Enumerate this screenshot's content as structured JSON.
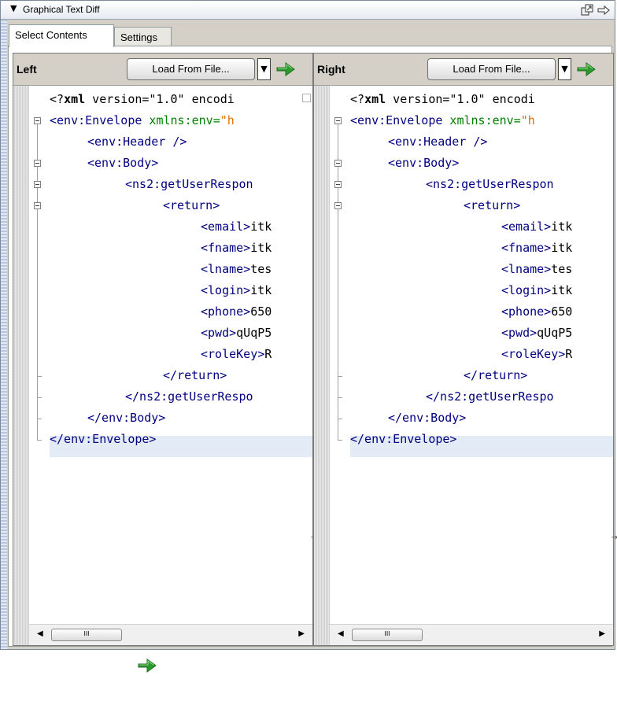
{
  "panel": {
    "title": "Graphical Text Diff",
    "collapse_icon": "triangle-down-icon",
    "icons": [
      "undock-icon",
      "arrow-right-icon"
    ]
  },
  "tabs": [
    {
      "label": "Select Contents",
      "active": true
    },
    {
      "label": "Settings",
      "active": false
    }
  ],
  "left": {
    "label": "Left",
    "load_button": "Load From File...",
    "code": [
      {
        "pi_tag": "xml",
        "rest": " version=\"1.0\" encodi"
      },
      {
        "tag": "<env:Envelope",
        "attr": " xmlns:env=",
        "val": "\"h"
      },
      {
        "tag": "<env:Header />"
      },
      {
        "tag": "<env:Body>"
      },
      {
        "tag": "<ns2:getUserRespon"
      },
      {
        "tag": "<return>"
      },
      {
        "tag": "<email>",
        "text": "itk"
      },
      {
        "tag": "<fname>",
        "text": "itk"
      },
      {
        "tag": "<lname>",
        "text": "tes"
      },
      {
        "tag": "<login>",
        "text": "itk"
      },
      {
        "tag": "<phone>",
        "text": "650"
      },
      {
        "tag": "<pwd>",
        "text": "qUqP5"
      },
      {
        "tag": "<roleKey>",
        "text": "R"
      },
      {
        "tag": "</return>"
      },
      {
        "tag": "</ns2:getUserRespo"
      },
      {
        "tag": "</env:Body>"
      },
      {
        "tag": "</env:Envelope>"
      }
    ],
    "scroll_thumb": "III"
  },
  "right": {
    "label": "Right",
    "load_button": "Load From File...",
    "code": [
      {
        "pi_tag": "xml",
        "rest": " version=\"1.0\" encodi"
      },
      {
        "tag": "<env:Envelope",
        "attr": " xmlns:env=",
        "val": "\"h"
      },
      {
        "tag": "<env:Header />"
      },
      {
        "tag": "<env:Body>"
      },
      {
        "tag": "<ns2:getUserRespon"
      },
      {
        "tag": "<return>"
      },
      {
        "tag": "<email>",
        "text": "itk"
      },
      {
        "tag": "<fname>",
        "text": "itk"
      },
      {
        "tag": "<lname>",
        "text": "tes"
      },
      {
        "tag": "<login>",
        "text": "itk"
      },
      {
        "tag": "<phone>",
        "text": "650"
      },
      {
        "tag": "<pwd>",
        "text": "qUqP5"
      },
      {
        "tag": "<roleKey>",
        "text": "R"
      },
      {
        "tag": "</return>"
      },
      {
        "tag": "</ns2:getUserRespo"
      },
      {
        "tag": "</env:Body>"
      },
      {
        "tag": "</env:Envelope>"
      }
    ],
    "scroll_thumb": "III"
  },
  "colors": {
    "tag": "#000080",
    "attr": "#008000",
    "value": "#e07000",
    "go_arrow": "#2e9a2e"
  }
}
